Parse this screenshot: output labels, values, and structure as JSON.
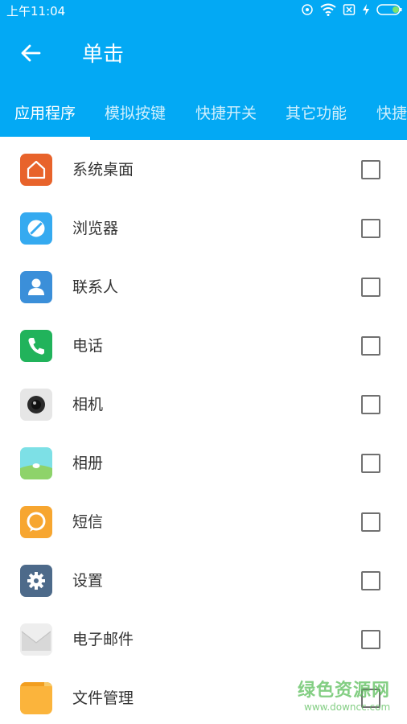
{
  "status_bar": {
    "time": "上午11:04",
    "icons": [
      "alarm-icon",
      "wifi-icon",
      "no-sim-icon",
      "charging-icon",
      "battery-icon"
    ]
  },
  "app_bar": {
    "back_icon": "arrow-left-icon",
    "title": "单击"
  },
  "tabs": [
    {
      "label": "应用程序",
      "active": true
    },
    {
      "label": "模拟按键",
      "active": false
    },
    {
      "label": "快捷开关",
      "active": false
    },
    {
      "label": "其它功能",
      "active": false
    },
    {
      "label": "快捷",
      "active": false
    }
  ],
  "items": [
    {
      "label": "系统桌面",
      "icon": "home-icon",
      "color": "#e8632b",
      "checked": false
    },
    {
      "label": "浏览器",
      "icon": "browser-icon",
      "color": "#35aaf0",
      "checked": false
    },
    {
      "label": "联系人",
      "icon": "contacts-icon",
      "color": "#3b8fd9",
      "checked": false
    },
    {
      "label": "电话",
      "icon": "phone-icon",
      "color": "#21b35b",
      "checked": false
    },
    {
      "label": "相机",
      "icon": "camera-icon",
      "color": "#e6e6e6",
      "checked": false
    },
    {
      "label": "相册",
      "icon": "gallery-icon",
      "color": "#8ed36a",
      "checked": false
    },
    {
      "label": "短信",
      "icon": "messages-icon",
      "color": "#f7a630",
      "checked": false
    },
    {
      "label": "设置",
      "icon": "settings-icon",
      "color": "#4d6a8a",
      "checked": false
    },
    {
      "label": "电子邮件",
      "icon": "email-icon",
      "color": "#eeeeee",
      "checked": false
    },
    {
      "label": "文件管理",
      "icon": "file-manager-icon",
      "color": "#fbb43c",
      "checked": false
    }
  ],
  "watermark": {
    "text": "绿色资源网",
    "url": "www.downcc.com"
  },
  "colors": {
    "primary": "#03a9f4",
    "text": "#333333",
    "checkbox_border": "#707070"
  }
}
